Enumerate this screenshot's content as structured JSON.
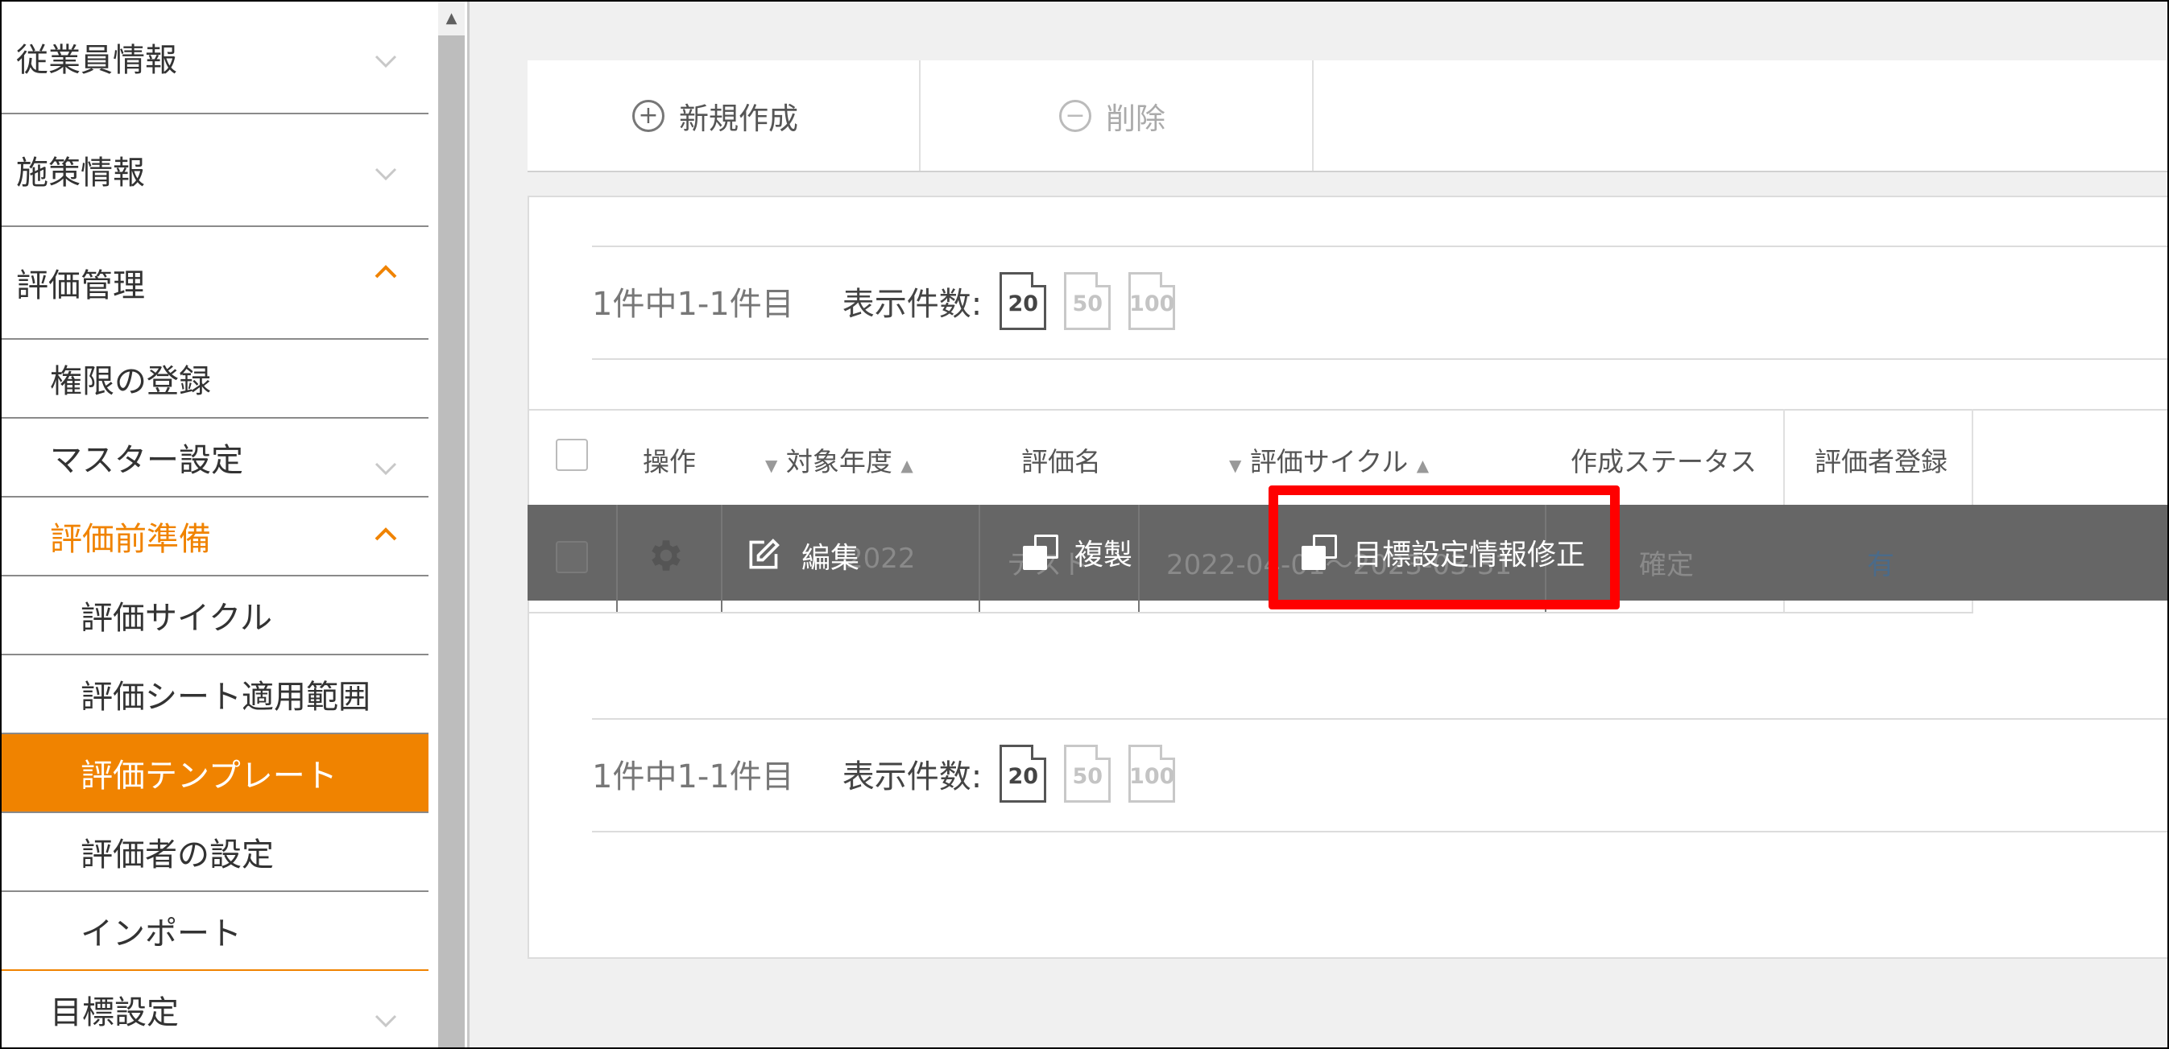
{
  "sidebar": {
    "items": [
      {
        "label": "従業員情報",
        "level": 0,
        "expanded": false,
        "active": false
      },
      {
        "label": "施策情報",
        "level": 0,
        "expanded": false,
        "active": false
      },
      {
        "label": "評価管理",
        "level": 0,
        "expanded": true,
        "active": false
      },
      {
        "label": "権限の登録",
        "level": 1,
        "expanded": null,
        "active": false
      },
      {
        "label": "マスター設定",
        "level": 1,
        "expanded": false,
        "active": false
      },
      {
        "label": "評価前準備",
        "level": 1,
        "expanded": true,
        "active": false
      },
      {
        "label": "評価サイクル",
        "level": 2,
        "expanded": null,
        "active": false
      },
      {
        "label": "評価シート適用範囲",
        "level": 2,
        "expanded": null,
        "active": false
      },
      {
        "label": "評価テンプレート",
        "level": 2,
        "expanded": null,
        "active": true
      },
      {
        "label": "評価者の設定",
        "level": 2,
        "expanded": null,
        "active": false
      },
      {
        "label": "インポート",
        "level": 2,
        "expanded": null,
        "active": false
      },
      {
        "label": "目標設定",
        "level": 1,
        "expanded": false,
        "active": false
      }
    ]
  },
  "toolbar": {
    "new_label": "新規作成",
    "delete_label": "削除"
  },
  "pager_top": {
    "range": "1件中1-1件目",
    "count_label": "表示件数:",
    "sizes": [
      "20",
      "50",
      "100"
    ],
    "selected": "20"
  },
  "pager_bottom": {
    "range": "1件中1-1件目",
    "count_label": "表示件数:",
    "sizes": [
      "20",
      "50",
      "100"
    ],
    "selected": "20"
  },
  "table": {
    "headers": {
      "action": "操作",
      "year": "対象年度",
      "name": "評価名",
      "cycle": "評価サイクル",
      "status": "作成ステータス",
      "evaluator": "評価者登録"
    },
    "row": {
      "year": "2022",
      "name": "テスト",
      "cycle": "2022-04-01〜2023-03-31",
      "status": "確定",
      "evaluator": "有"
    }
  },
  "row_actions": {
    "edit": "編集",
    "duplicate": "複製",
    "fix_goal": "目標設定情報修正"
  },
  "colors": {
    "accent": "#f08300",
    "overlay": "#666666",
    "highlight": "#ff0000"
  }
}
